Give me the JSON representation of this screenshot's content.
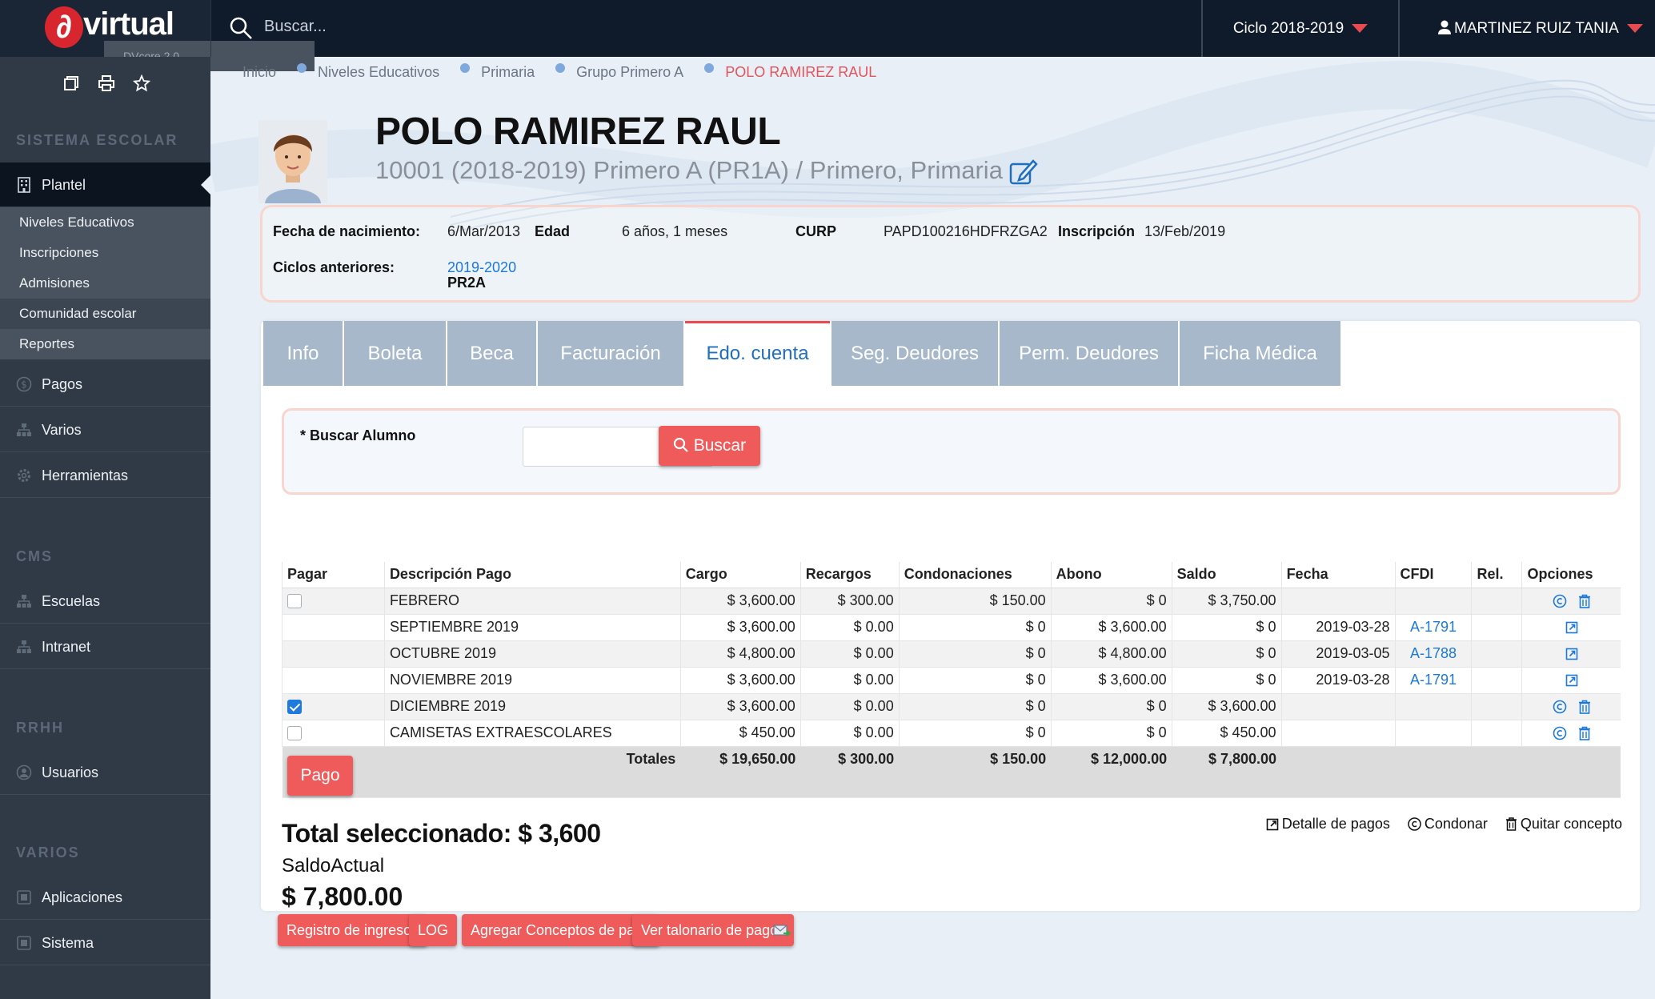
{
  "app": {
    "logo_text": "virtual",
    "logo_sub": "DVcore 2.0"
  },
  "topbar": {
    "search_placeholder": "Buscar...",
    "ciclo": "Ciclo 2018-2019",
    "user": "MARTINEZ RUIZ TANIA"
  },
  "sidebar": {
    "sections": {
      "escolar": "SISTEMA ESCOLAR",
      "cms": "CMS",
      "rrhh": "RRHH",
      "varios": "VARIOS"
    },
    "plantel": "Plantel",
    "plantel_sub": [
      "Niveles Educativos",
      "Inscripciones",
      "Admisiones",
      "Comunidad escolar",
      "Reportes"
    ],
    "pagos": "Pagos",
    "varios": "Varios",
    "herramientas": "Herramientas",
    "escuelas": "Escuelas",
    "intranet": "Intranet",
    "usuarios": "Usuarios",
    "aplicaciones": "Aplicaciones",
    "sistema": "Sistema"
  },
  "breadcrumb": [
    "Inicio",
    "Niveles Educativos",
    "Primaria",
    "Grupo Primero A",
    "POLO RAMIREZ RAUL"
  ],
  "student": {
    "name": "POLO RAMIREZ RAUL",
    "subtitle": "10001 (2018-2019) Primero A (PR1A) / Primero, Primaria"
  },
  "info": {
    "fecha_nac_label": "Fecha de nacimiento:",
    "fecha_nac": "6/Mar/2013",
    "edad_label": "Edad",
    "edad": "6 años, 1 meses",
    "curp_label": "CURP",
    "curp": "PAPD100216HDFRZGA2",
    "inscripcion_label": "Inscripción",
    "inscripcion": "13/Feb/2019",
    "ciclos_label": "Ciclos anteriores:",
    "ciclo_link": "2019-2020",
    "ciclo_group": "PR2A"
  },
  "tabs": [
    "Info",
    "Boleta",
    "Beca",
    "Facturación",
    "Edo. cuenta",
    "Seg. Deudores",
    "Perm. Deudores",
    "Ficha Médica"
  ],
  "active_tab": "Edo. cuenta",
  "search": {
    "label": "* Buscar Alumno",
    "value": "",
    "button": "Buscar"
  },
  "table": {
    "headers": [
      "Pagar",
      "Descripción Pago",
      "Cargo",
      "Recargos",
      "Condonaciones",
      "Abono",
      "Saldo",
      "Fecha",
      "CFDI",
      "Rel.",
      "Opciones"
    ],
    "rows": [
      {
        "checkbox": "unchecked",
        "desc": "FEBRERO",
        "cargo": "$ 3,600.00",
        "recargos": "$ 300.00",
        "cond": "$ 150.00",
        "abono": "$ 0",
        "saldo": "$ 3,750.00",
        "fecha": "",
        "cfdi": "",
        "rel": "",
        "opts": "cond-del"
      },
      {
        "checkbox": "none",
        "desc": "SEPTIEMBRE 2019",
        "cargo": "$ 3,600.00",
        "recargos": "$ 0.00",
        "cond": "$ 0",
        "abono": "$ 3,600.00",
        "saldo": "$ 0",
        "fecha": "2019-03-28",
        "cfdi": "A-1791",
        "rel": "",
        "opts": "detail"
      },
      {
        "checkbox": "none",
        "desc": "OCTUBRE 2019",
        "cargo": "$ 4,800.00",
        "recargos": "$ 0.00",
        "cond": "$ 0",
        "abono": "$ 4,800.00",
        "saldo": "$ 0",
        "fecha": "2019-03-05",
        "cfdi": "A-1788",
        "rel": "",
        "opts": "detail"
      },
      {
        "checkbox": "none",
        "desc": "NOVIEMBRE 2019",
        "cargo": "$ 3,600.00",
        "recargos": "$ 0.00",
        "cond": "$ 0",
        "abono": "$ 3,600.00",
        "saldo": "$ 0",
        "fecha": "2019-03-28",
        "cfdi": "A-1791",
        "rel": "",
        "opts": "detail"
      },
      {
        "checkbox": "checked",
        "desc": "DICIEMBRE 2019",
        "cargo": "$ 3,600.00",
        "recargos": "$ 0.00",
        "cond": "$ 0",
        "abono": "$ 0",
        "saldo": "$ 3,600.00",
        "fecha": "",
        "cfdi": "",
        "rel": "",
        "opts": "cond-del"
      },
      {
        "checkbox": "unchecked",
        "desc": "CAMISETAS EXTRAESCOLARES",
        "cargo": "$ 450.00",
        "recargos": "$ 0.00",
        "cond": "$ 0",
        "abono": "$ 0",
        "saldo": "$ 450.00",
        "fecha": "",
        "cfdi": "",
        "rel": "",
        "opts": "cond-del"
      }
    ],
    "totals": {
      "label": "Totales",
      "cargo": "$ 19,650.00",
      "recargos": "$ 300.00",
      "cond": "$ 150.00",
      "abono": "$ 12,000.00",
      "saldo": "$ 7,800.00"
    },
    "pago_button": "Pago"
  },
  "summary": {
    "total_sel": "Total seleccionado: $ 3,600",
    "saldo_label": "SaldoActual",
    "saldo_value": "$ 7,800.00"
  },
  "actions": {
    "detalle": "Detalle de pagos",
    "condonar": "Condonar",
    "quitar": "Quitar concepto"
  },
  "bottom_buttons": [
    "Registro de ingresos",
    "LOG",
    "Agregar Conceptos de pago",
    "Ver talonario de pagos"
  ],
  "colors": {
    "accent": "#ef5b5b",
    "link": "#1c79d6",
    "sidebar": "#303a46",
    "topbar": "#0f1a2b"
  }
}
